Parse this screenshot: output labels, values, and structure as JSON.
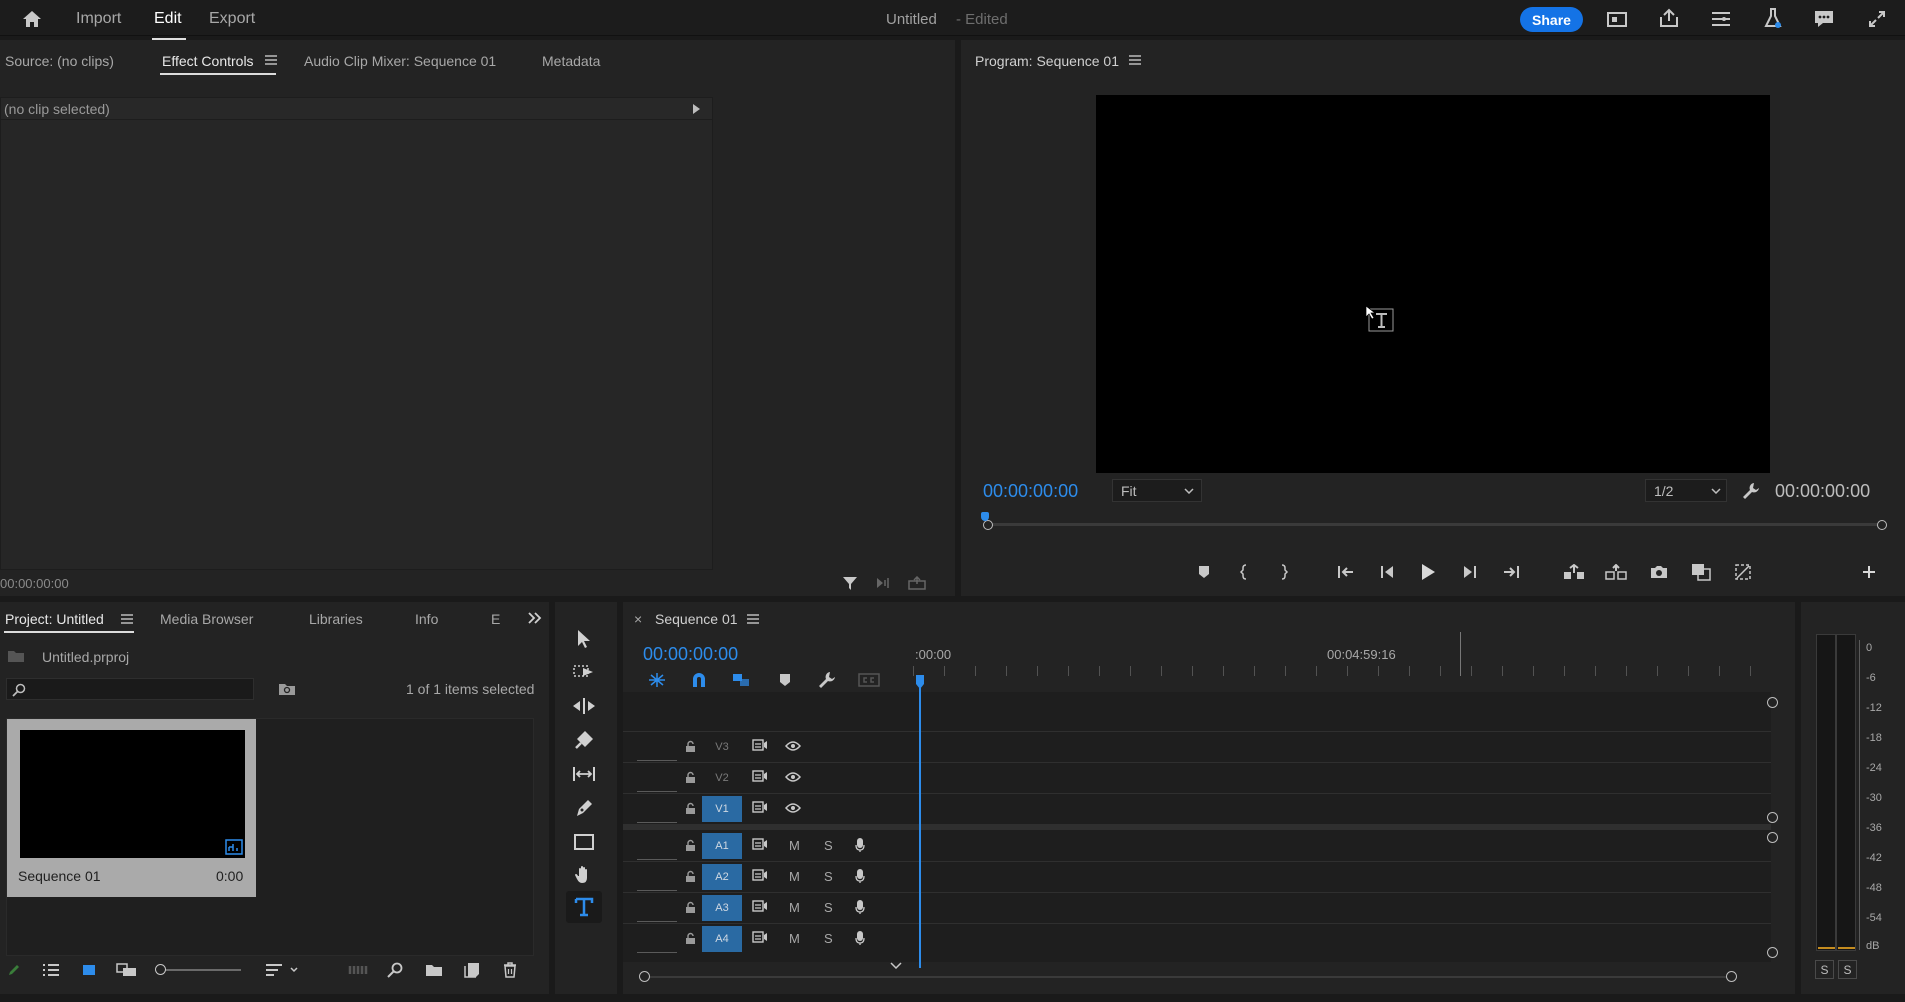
{
  "topbar": {
    "nav": [
      "Import",
      "Edit",
      "Export"
    ],
    "doc_title": "Untitled",
    "doc_status": "- Edited",
    "share_label": "Share"
  },
  "source_panel": {
    "tabs": [
      "Source: (no clips)",
      "Effect Controls",
      "Audio Clip Mixer: Sequence 01",
      "Metadata"
    ],
    "active_tab": "Effect Controls",
    "no_clip_text": "(no clip selected)",
    "footer_timecode": "00:00:00:00"
  },
  "program_monitor": {
    "title": "Program: Sequence 01",
    "current_timecode": "00:00:00:00",
    "zoom_value": "Fit",
    "resolution_value": "1/2",
    "duration_timecode": "00:00:00:00"
  },
  "project_panel": {
    "tabs": [
      "Project: Untitled",
      "Media Browser",
      "Libraries",
      "Info",
      "E"
    ],
    "file_name": "Untitled.prproj",
    "selection_status": "1 of 1 items selected",
    "items": [
      {
        "name": "Sequence 01",
        "duration": "0:00"
      }
    ]
  },
  "timeline": {
    "sequence_tab": "Sequence 01",
    "close_symbol": "×",
    "current_timecode": "00:00:00:00",
    "ruler_labels": [
      ":00:00",
      "00:04:59:16"
    ],
    "video_tracks": [
      "V3",
      "V2",
      "V1"
    ],
    "audio_tracks": [
      "A1",
      "A2",
      "A3",
      "A4"
    ],
    "mute_label": "M",
    "solo_label": "S"
  },
  "audio_meter": {
    "scale": [
      "0",
      "-6",
      "-12",
      "-18",
      "-24",
      "-30",
      "-36",
      "-42",
      "-48",
      "-54",
      "dB"
    ],
    "solo_buttons": [
      "S",
      "S"
    ]
  },
  "colors": {
    "accent": "#2d8ceb",
    "share": "#1473e6",
    "track_on": "#2a6aa3",
    "panel_bg": "#232323",
    "app_bg": "#1a1a1a"
  }
}
